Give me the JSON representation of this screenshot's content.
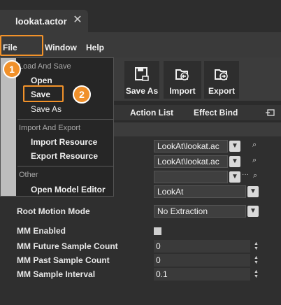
{
  "tab": {
    "title": "lookat.actor"
  },
  "menubar": {
    "file": "File",
    "window": "Window",
    "help": "Help"
  },
  "toolbar": {
    "save_as": "Save As",
    "import": "Import",
    "export": "Export"
  },
  "tabs": {
    "action_list": "Action List",
    "effect_bind": "Effect Bind"
  },
  "fields": {
    "lookat_1": "LookAt\\lookat.ac",
    "lookat_2": "LookAt\\lookat.ac",
    "lookat_3": "",
    "lookat_dropdown": "LookAt",
    "root_motion_mode_label": "Root Motion Mode",
    "root_motion_mode_value": "No Extraction",
    "mm_enabled_label": "MM Enabled",
    "mm_future_label": "MM Future Sample Count",
    "mm_future_value": "0",
    "mm_past_label": "MM Past Sample Count",
    "mm_past_value": "0",
    "mm_interval_label": "MM Sample Interval",
    "mm_interval_value": "0.1"
  },
  "file_menu": {
    "section_load_save": "Load And Save",
    "open": "Open",
    "save": "Save",
    "save_as": "Save As",
    "section_import_export": "Import And Export",
    "import_resource": "Import Resource",
    "export_resource": "Export Resource",
    "section_other": "Other",
    "open_model_editor": "Open Model Editor"
  },
  "badges": {
    "step1": "1",
    "step2": "2"
  },
  "colors": {
    "accent": "#f2922a",
    "background": "#2b2b2b"
  },
  "icons": [
    "close-icon",
    "save-as-icon",
    "import-icon",
    "export-icon",
    "pin-icon",
    "search-icon",
    "chevron-down-icon",
    "ellipsis-icon",
    "spinner-icon"
  ]
}
